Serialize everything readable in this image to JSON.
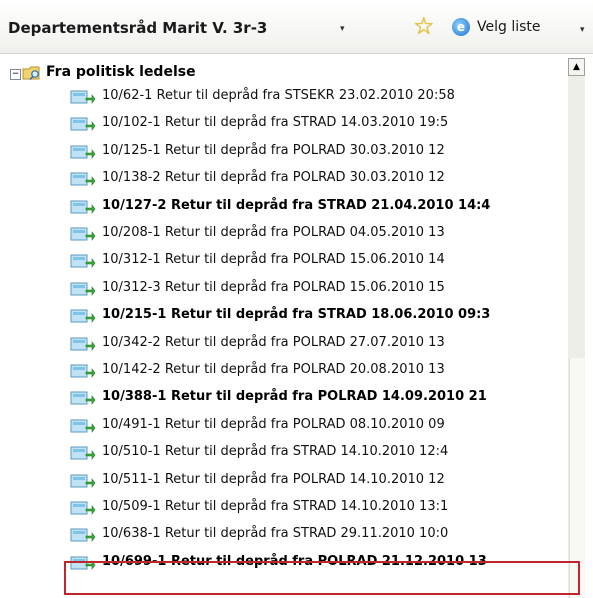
{
  "header": {
    "title": "Departementsråd Marit V. 3r-3",
    "title_dropdown": "▾",
    "velg_liste": "Velg liste",
    "velg_dropdown": "▾",
    "star_icon": "star-icon",
    "ie_icon": "ie-icon"
  },
  "tree": {
    "group": {
      "expander": "−",
      "label": "Fra politisk ledelse"
    },
    "items": [
      {
        "text": "10/62-1 Retur til depråd fra  STSEKR  23.02.2010 20:58",
        "bold": false
      },
      {
        "text": "10/102-1 Retur til depråd fra  STRAD  14.03.2010 19:5",
        "bold": false
      },
      {
        "text": "10/125-1 Retur til depråd fra  POLRAD  30.03.2010 12",
        "bold": false
      },
      {
        "text": "10/138-2 Retur til depråd fra  POLRAD  30.03.2010 12",
        "bold": false
      },
      {
        "text": "10/127-2 Retur til depråd fra  STRAD  21.04.2010 14:4",
        "bold": true
      },
      {
        "text": "10/208-1 Retur til depråd fra  POLRAD  04.05.2010 13",
        "bold": false
      },
      {
        "text": "10/312-1 Retur til depråd fra  POLRAD  15.06.2010 14",
        "bold": false
      },
      {
        "text": "10/312-3 Retur til depråd fra  POLRAD  15.06.2010 15",
        "bold": false
      },
      {
        "text": "10/215-1 Retur til depråd fra  STRAD  18.06.2010 09:3",
        "bold": true
      },
      {
        "text": "10/342-2 Retur til depråd fra  POLRAD  27.07.2010 13",
        "bold": false
      },
      {
        "text": "10/142-2 Retur til depråd fra  POLRAD  20.08.2010 13",
        "bold": false
      },
      {
        "text": "10/388-1 Retur til depråd fra  POLRAD  14.09.2010 21",
        "bold": true
      },
      {
        "text": "10/491-1 Retur til depråd fra  POLRAD  08.10.2010 09",
        "bold": false
      },
      {
        "text": "10/510-1 Retur til depråd fra  STRAD  14.10.2010 12:4",
        "bold": false
      },
      {
        "text": "10/511-1 Retur til depråd fra  POLRAD  14.10.2010 12",
        "bold": false
      },
      {
        "text": "10/509-1 Retur til depråd fra  STRAD  14.10.2010 13:1",
        "bold": false
      },
      {
        "text": "10/638-1 Retur til depråd fra  STRAD  29.11.2010 10:0",
        "bold": false
      },
      {
        "text": "10/699-1 Retur til depråd fra  POLRAD  21.12.2010 13",
        "bold": true,
        "selected": true
      }
    ]
  },
  "scrollbar": {
    "up_arrow": "▲"
  },
  "colors": {
    "selection_border": "#c0272d",
    "star": "#f2c40a",
    "header_bg": "#f0f0ec"
  }
}
